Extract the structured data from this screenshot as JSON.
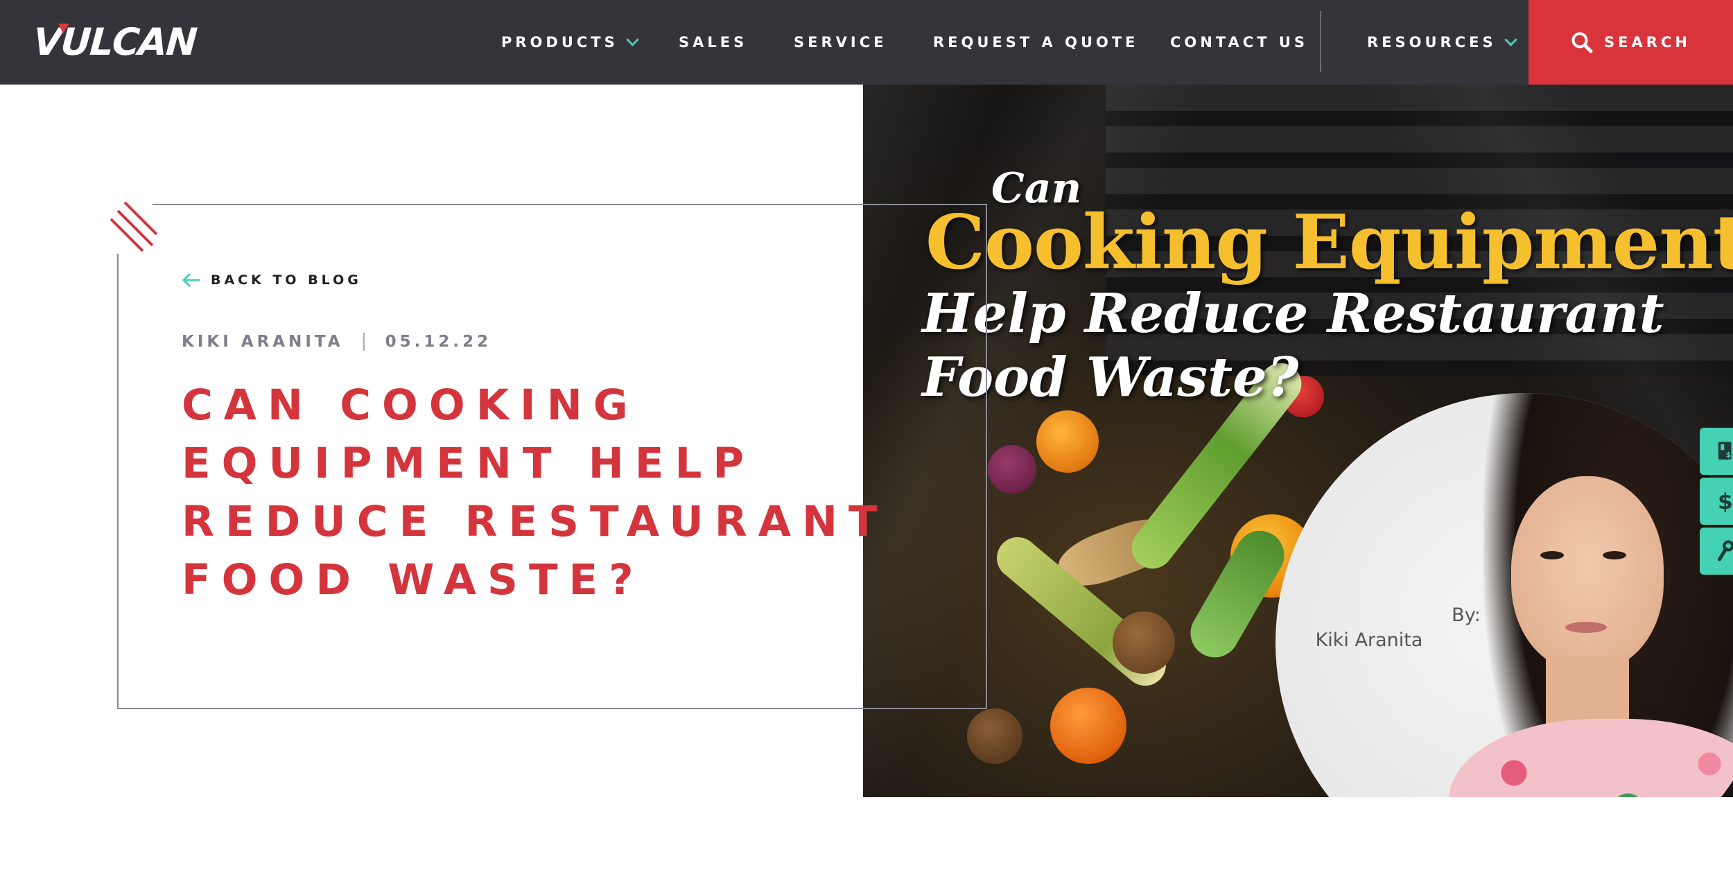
{
  "header": {
    "logo_text": "VULCAN",
    "nav": [
      {
        "label": "PRODUCTS",
        "has_dropdown": true
      },
      {
        "label": "SALES",
        "has_dropdown": false
      },
      {
        "label": "SERVICE",
        "has_dropdown": false
      },
      {
        "label": "REQUEST A QUOTE",
        "has_dropdown": false
      },
      {
        "label": "CONTACT US",
        "has_dropdown": false
      },
      {
        "label": "RESOURCES",
        "has_dropdown": true
      }
    ],
    "search_label": "SEARCH"
  },
  "article": {
    "back_label": "BACK TO BLOG",
    "author": "KIKI ARANITA",
    "date": "05.12.22",
    "title_lines": [
      "CAN COOKING",
      "EQUIPMENT HELP",
      "REDUCE RESTAURANT",
      "FOOD WASTE?"
    ]
  },
  "hero_image": {
    "line1": "Can",
    "line2": "Cooking Equipment",
    "line3": "Help Reduce Restaurant",
    "line4": "Food Waste?",
    "by_label": "By:",
    "by_name": "Kiki Aranita"
  },
  "side_tabs": [
    {
      "icon": "price-list-icon"
    },
    {
      "icon": "dollar-icon"
    },
    {
      "icon": "wrench-icon"
    }
  ],
  "colors": {
    "header_bg": "#35343a",
    "brand_red": "#d4353d",
    "accent_teal": "#45d1b3",
    "meta_gray": "#7f7e89",
    "hero_yellow": "#f6bf2e"
  }
}
